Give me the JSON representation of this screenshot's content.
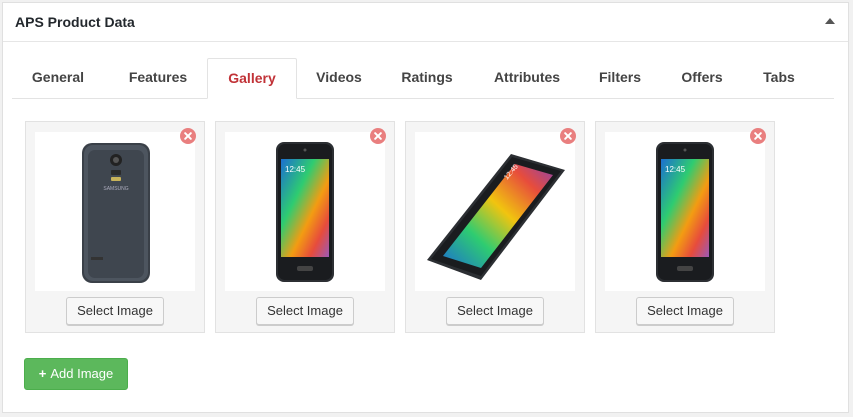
{
  "panel": {
    "title": "APS Product Data"
  },
  "tabs": [
    {
      "label": "General",
      "active": false
    },
    {
      "label": "Features",
      "active": false
    },
    {
      "label": "Gallery",
      "active": true
    },
    {
      "label": "Videos",
      "active": false
    },
    {
      "label": "Ratings",
      "active": false
    },
    {
      "label": "Attributes",
      "active": false
    },
    {
      "label": "Filters",
      "active": false
    },
    {
      "label": "Offers",
      "active": false
    },
    {
      "label": "Tabs",
      "active": false
    }
  ],
  "gallery": {
    "items": [
      {
        "image": "phone-back-icon",
        "button_label": "Select Image"
      },
      {
        "image": "phone-front-icon",
        "button_label": "Select Image"
      },
      {
        "image": "phone-angled-icon",
        "button_label": "Select Image"
      },
      {
        "image": "phone-front-icon",
        "button_label": "Select Image"
      }
    ],
    "add_label": "Add Image"
  },
  "colors": {
    "active_tab": "#c13237",
    "add_button": "#5cb85c",
    "remove_icon": "#e97f7f"
  }
}
